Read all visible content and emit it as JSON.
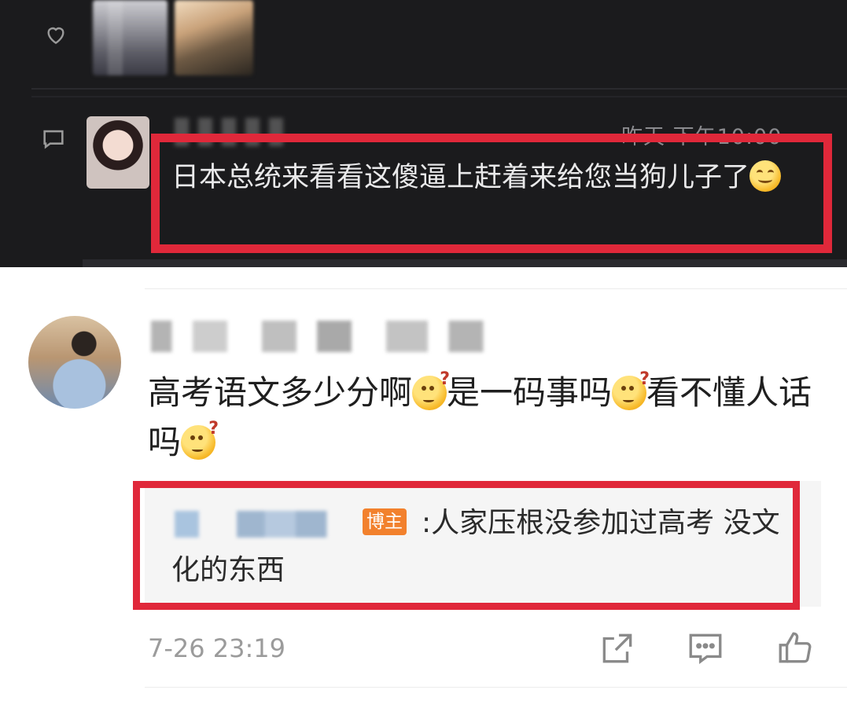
{
  "screenshot_inset": {
    "time": "昨天 下午10:00",
    "comment_text": "日本总统来看看这傻逼上赶着来给您当狗儿子了",
    "emoji": "smile-emoji"
  },
  "comment": {
    "text_parts": [
      "高考语文多少分啊",
      "是一码事吗",
      "看不懂人话吗"
    ],
    "emoji": "thinking-emoji",
    "timestamp": "7-26 23:19"
  },
  "reply": {
    "badge": "博主",
    "text": ":人家压根没参加过高考 没文化的东西"
  },
  "actions": {
    "share_icon": "share-icon",
    "reply_icon": "comment-icon",
    "like_icon": "thumbs-up-icon"
  },
  "colors": {
    "highlight": "#e0283a",
    "badge": "#f2812d",
    "dark_bg": "#1b1b1d"
  }
}
